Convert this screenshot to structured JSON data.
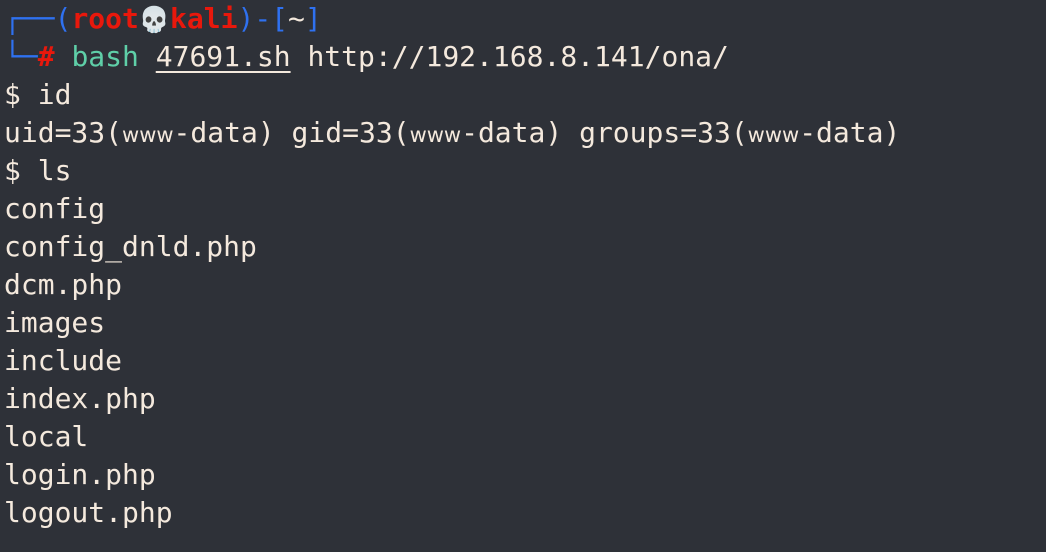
{
  "terminal": {
    "background_color": "#2e3138",
    "foreground_color": "#f4e9dd",
    "accent_red": "#e8180c",
    "accent_blue": "#2f71f0",
    "accent_teal": "#5fcfa8",
    "prompt": {
      "box_top": "┌──",
      "box_bottom": "└─",
      "open_paren": "(",
      "user": "root",
      "separator_icon": "💀",
      "host": "kali",
      "close_paren": ")",
      "dash": "-",
      "open_bracket": "[",
      "path": "~",
      "close_bracket": "]",
      "sigil": "#"
    },
    "command": {
      "name": "bash",
      "script": "47691.sh",
      "url": "http://192.168.8.141/ona/"
    },
    "session": [
      {
        "type": "shell-prompt",
        "prompt": "$",
        "command": "id"
      },
      {
        "type": "output",
        "text": "uid=33(www-data) gid=33(www-data) groups=33(www-data)",
        "segments": [
          {
            "text": "uid=33(",
            "style": "plain"
          },
          {
            "text": "www",
            "style": "smallcaps"
          },
          {
            "text": "-data) gid=33(",
            "style": "plain"
          },
          {
            "text": "www",
            "style": "smallcaps"
          },
          {
            "text": "-data) groups=33(",
            "style": "plain"
          },
          {
            "text": "www",
            "style": "smallcaps"
          },
          {
            "text": "-data)",
            "style": "plain"
          }
        ]
      },
      {
        "type": "shell-prompt",
        "prompt": "$",
        "command": "ls"
      },
      {
        "type": "output",
        "text": "config"
      },
      {
        "type": "output",
        "text": "config_dnld.php"
      },
      {
        "type": "output",
        "text": "dcm.php"
      },
      {
        "type": "output",
        "text": "images"
      },
      {
        "type": "output",
        "text": "include"
      },
      {
        "type": "output",
        "text": "index.php"
      },
      {
        "type": "output",
        "text": "local"
      },
      {
        "type": "output",
        "text": "login.php"
      },
      {
        "type": "output",
        "text": "logout.php"
      }
    ]
  }
}
